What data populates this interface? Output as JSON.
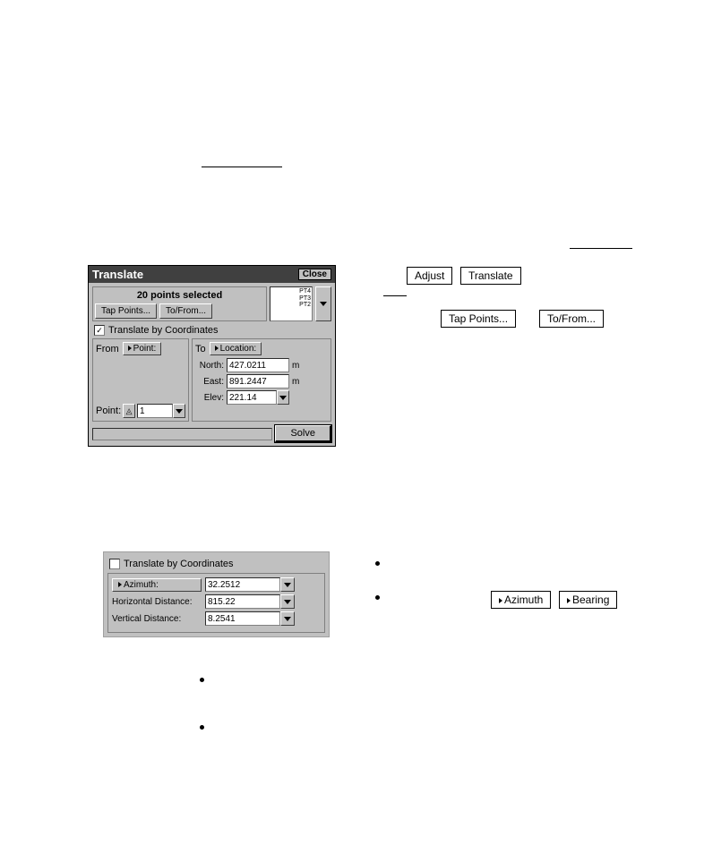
{
  "dialog": {
    "title": "Translate",
    "close": "Close",
    "selection_title": "20 points selected",
    "tap_points": "Tap Points...",
    "to_from": "To/From...",
    "preview_lines": [
      "PT4",
      "PT3",
      "PT2"
    ],
    "translate_by_coords_label": "Translate by Coordinates",
    "translate_by_coords_checked": true,
    "from_label": "From",
    "from_point_btn": "Point:",
    "point_label": "Point:",
    "point_value": "1",
    "to_label": "To",
    "to_location_btn": "Location:",
    "north_label": "North:",
    "north_value": "427.0211",
    "east_label": "East:",
    "east_value": "891.2447",
    "elev_label": "Elev:",
    "elev_value": "221.14",
    "unit_m": "m",
    "solve": "Solve"
  },
  "snippet2": {
    "translate_by_coords_label": "Translate by Coordinates",
    "translate_by_coords_checked": false,
    "azimuth_btn": "Azimuth:",
    "azimuth_value": "32.2512",
    "hdist_label": "Horizontal Distance:",
    "hdist_value": "815.22",
    "vdist_label": "Vertical Distance:",
    "vdist_value": "8.2541"
  },
  "doc_buttons": {
    "adjust": "Adjust",
    "translate": "Translate",
    "tap_points": "Tap Points...",
    "to_from": "To/From...",
    "azimuth": "Azimuth",
    "bearing": "Bearing"
  }
}
